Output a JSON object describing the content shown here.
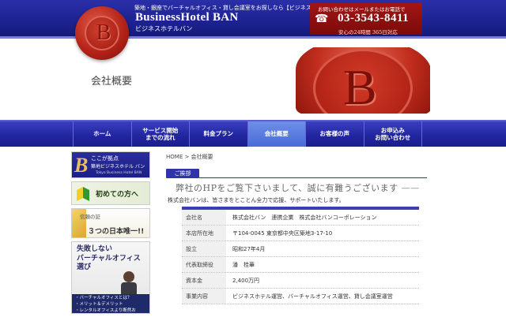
{
  "header": {
    "tagline": "築地・銀座でバーチャルオフィス・貸し会議室をお探しなら【ビジネスホテルバン】東京都中央区",
    "brand": "BusinessHotel BAN",
    "brand_kana": "ビジネスホテルバン",
    "contact_note": "お問い合わせはメールまたはお電話で",
    "phone": "03-3543-8411",
    "hours": "安心の24時間 365日対応",
    "seal_letter": "B",
    "colors": {
      "header_blue": "#1d2290",
      "seal_red": "#b52418",
      "nav_active": "#5a7ae0"
    }
  },
  "page": {
    "heading": "会社概要"
  },
  "nav": {
    "items": [
      {
        "label": "ホーム"
      },
      {
        "label": "サービス開始\nまでの流れ"
      },
      {
        "label": "料金プラン"
      },
      {
        "label": "会社概要"
      },
      {
        "label": "お客様の声"
      },
      {
        "label": "お申込み\nお問い合わせ"
      }
    ]
  },
  "sidebar": {
    "banner1": {
      "logo": "B",
      "line1": "ここが拠点",
      "line2": "築地ビジネスホテル バン",
      "line3": "Tokyo Business Hotel BAN"
    },
    "banner2": {
      "text": "初めての方へ"
    },
    "banner3": {
      "line1": "信頼の証",
      "line2": "３つの日本唯一!!"
    },
    "banner4": {
      "title": "失敗しない\nバーチャルオフィス\n選び",
      "items": [
        "・バーチャルオフィスとは？",
        "・メリット＆デメリット",
        "・レンタルオフィスより断然お得！！"
      ]
    }
  },
  "main": {
    "breadcrumb": "HOME > 会社概要",
    "greeting_tag": "ご挨拶",
    "headline": "弊社のHPをご覧下さいまして、誠に有難うございます",
    "headline_dash": "——",
    "lead": "株式会社バンは、皆さまをとことん全力で応援、サポートいたします。",
    "company_table": [
      {
        "label": "会社名",
        "value": "株式会社バン　連携企業　株式会社バンコーポレーション"
      },
      {
        "label": "本店所在地",
        "value": "〒104-0045 東京都中央区築地3-17-10"
      },
      {
        "label": "設立",
        "value": "昭和27年4月"
      },
      {
        "label": "代表取締役",
        "value": "潘　桂華"
      },
      {
        "label": "資本金",
        "value": "2,400万円"
      },
      {
        "label": "事業内容",
        "value": "ビジネスホテル運営、バーチャルオフィス運営、貸し会議室運営"
      }
    ]
  }
}
